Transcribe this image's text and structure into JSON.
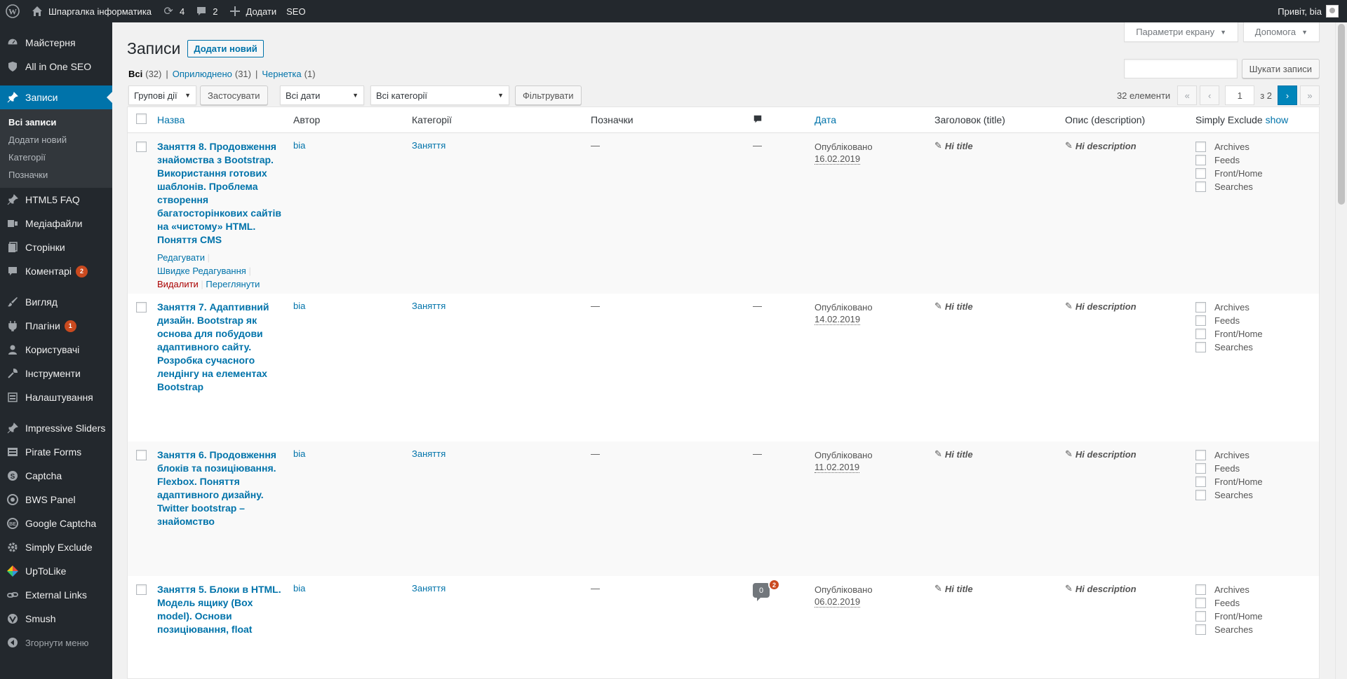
{
  "adminbar": {
    "site_name": "Шпаргалка інформатика",
    "updates_count": "4",
    "comments_count": "2",
    "new_label": "Додати",
    "seo_label": "SEO",
    "greeting": "Привіт, bia"
  },
  "sidebar": {
    "items": [
      {
        "label": "Майстерня",
        "icon": "dashboard-icon"
      },
      {
        "label": "All in One SEO",
        "icon": "shield-icon"
      },
      {
        "label": "Записи",
        "icon": "pin-icon"
      },
      {
        "label": "HTML5 FAQ",
        "icon": "pin-icon"
      },
      {
        "label": "Медіафайли",
        "icon": "media-icon"
      },
      {
        "label": "Сторінки",
        "icon": "pages-icon"
      },
      {
        "label": "Коментарі",
        "icon": "comment-icon",
        "badge": "2"
      },
      {
        "label": "Вигляд",
        "icon": "brush-icon"
      },
      {
        "label": "Плагіни",
        "icon": "plugin-icon",
        "badge": "1"
      },
      {
        "label": "Користувачі",
        "icon": "users-icon"
      },
      {
        "label": "Інструменти",
        "icon": "tools-icon"
      },
      {
        "label": "Налаштування",
        "icon": "settings-icon"
      },
      {
        "label": "Impressive Sliders",
        "icon": "pin-icon"
      },
      {
        "label": "Pirate Forms",
        "icon": "forms-icon"
      },
      {
        "label": "Captcha",
        "icon": "captcha-icon"
      },
      {
        "label": "BWS Panel",
        "icon": "bws-icon"
      },
      {
        "label": "Google Captcha",
        "icon": "gcaptcha-icon"
      },
      {
        "label": "Simply Exclude",
        "icon": "gear-icon"
      },
      {
        "label": "UpToLike",
        "icon": "uptolike-icon"
      },
      {
        "label": "External Links",
        "icon": "link-icon"
      },
      {
        "label": "Smush",
        "icon": "smush-icon"
      }
    ],
    "submenu": [
      "Всі записи",
      "Додати новий",
      "Категорії",
      "Позначки"
    ],
    "collapse": "Згорнути меню"
  },
  "screen_options": "Параметри екрану",
  "help": "Допомога",
  "page": {
    "title": "Записи",
    "add_new": "Додати новий"
  },
  "views": {
    "all": "Всі",
    "all_count": "(32)",
    "published": "Оприлюднено",
    "published_count": "(31)",
    "draft": "Чернетка",
    "draft_count": "(1)",
    "sep": "|"
  },
  "search": {
    "value": "",
    "button": "Шукати записи"
  },
  "tablenav": {
    "bulk_actions": "Групові дії",
    "apply": "Застосувати",
    "all_dates": "Всі дати",
    "all_categories": "Всі категорії",
    "filter": "Фільтрувати",
    "items_count": "32 елементи",
    "first": "«",
    "prev": "‹",
    "current_page": "1",
    "of_pages": "з 2",
    "next": "›",
    "last": "»"
  },
  "columns": {
    "title": "Назва",
    "author": "Автор",
    "categories": "Категорії",
    "tags": "Позначки",
    "date": "Дата",
    "seo_title": "Заголовок (title)",
    "seo_desc": "Опис (description)",
    "simply_exclude": "Simply Exclude",
    "show": "show"
  },
  "row_actions": {
    "edit": "Редагувати",
    "quick_edit": "Швидке Редагування",
    "trash": "Видалити",
    "view": "Переглянути"
  },
  "posts": [
    {
      "title": "Заняття 8. Продовження знайомства з Bootstrap. Використання готових шаблонів. Проблема створення багатосторінкових сайтів на «чистому» HTML. Поняття CMS",
      "author": "bia",
      "category": "Заняття",
      "tags": "—",
      "comments": "—",
      "status": "Опубліковано",
      "date": "16.02.2019",
      "seo_title": "Hi title",
      "seo_desc": "Hi description"
    },
    {
      "title": "Заняття 7. Адаптивний дизайн. Bootstrap як основа для побудови адаптивного сайту. Розробка сучасного лендінгу на елементах Bootstrap",
      "author": "bia",
      "category": "Заняття",
      "tags": "—",
      "comments": "—",
      "status": "Опубліковано",
      "date": "14.02.2019",
      "seo_title": "Hi title",
      "seo_desc": "Hi description"
    },
    {
      "title": "Заняття 6. Продовження блоків та позиціювання. Flexbox. Поняття адаптивного дизайну. Twitter bootstrap – знайомство",
      "author": "bia",
      "category": "Заняття",
      "tags": "—",
      "comments": "—",
      "status": "Опубліковано",
      "date": "11.02.2019",
      "seo_title": "Hi title",
      "seo_desc": "Hi description"
    },
    {
      "title": "Заняття 5. Блоки в HTML. Модель ящику (Box model). Основи позиціювання, float",
      "author": "bia",
      "category": "Заняття",
      "tags": "—",
      "comments_approved": "0",
      "comments_pending": "2",
      "status": "Опубліковано",
      "date": "06.02.2019",
      "seo_title": "Hi title",
      "seo_desc": "Hi description"
    }
  ],
  "exclude_options": [
    "Archives",
    "Feeds",
    "Front/Home",
    "Searches"
  ]
}
